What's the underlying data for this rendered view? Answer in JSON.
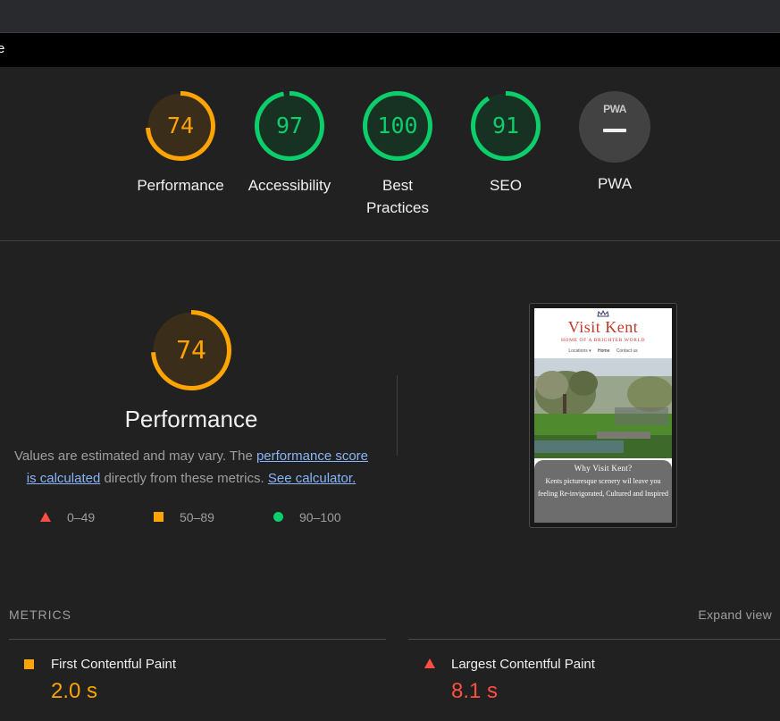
{
  "url_fragment": "e",
  "scores": [
    {
      "label": "Performance",
      "value": "74",
      "fraction": 0.74,
      "color": "#ffa400",
      "bg": "#3a2d1a"
    },
    {
      "label": "Accessibility",
      "value": "97",
      "fraction": 0.97,
      "color": "#0cce6b",
      "bg": "#173223"
    },
    {
      "label": "Best Practices",
      "value": "100",
      "fraction": 1.0,
      "color": "#0cce6b",
      "bg": "#173223"
    },
    {
      "label": "SEO",
      "value": "91",
      "fraction": 0.91,
      "color": "#0cce6b",
      "bg": "#173223"
    }
  ],
  "pwa": {
    "badge": "PWA",
    "label": "PWA"
  },
  "performance": {
    "score": "74",
    "fraction": 0.74,
    "title": "Performance",
    "desc_prefix": "Values are estimated and may vary. The ",
    "link1": "performance score is calculated",
    "desc_middle": " directly from these metrics. ",
    "link2": "See calculator."
  },
  "legend": {
    "fail": "0–49",
    "average": "50–89",
    "pass": "90–100"
  },
  "screenshot": {
    "site_title": "Visit Kent",
    "tagline": "HOME OF A BRIGHTER WORLD",
    "nav": [
      "Locations ▾",
      "Home",
      "Contact us"
    ],
    "why_title": "Why Visit Kent?",
    "why_body": "Kents picturesque scenery wil leave you feeling Re-invigorated, Cultured and Inspired"
  },
  "metrics": {
    "section_label": "METRICS",
    "expand_label": "Expand view",
    "items": [
      {
        "name": "First Contentful Paint",
        "value": "2.0 s",
        "status": "average",
        "color": "#ffa400"
      },
      {
        "name": "Largest Contentful Paint",
        "value": "8.1 s",
        "status": "fail",
        "color": "#ff4e42"
      }
    ]
  },
  "colors": {
    "pass": "#0cce6b",
    "average": "#ffa400",
    "fail": "#ff4e42",
    "link": "#8ab4f8"
  }
}
